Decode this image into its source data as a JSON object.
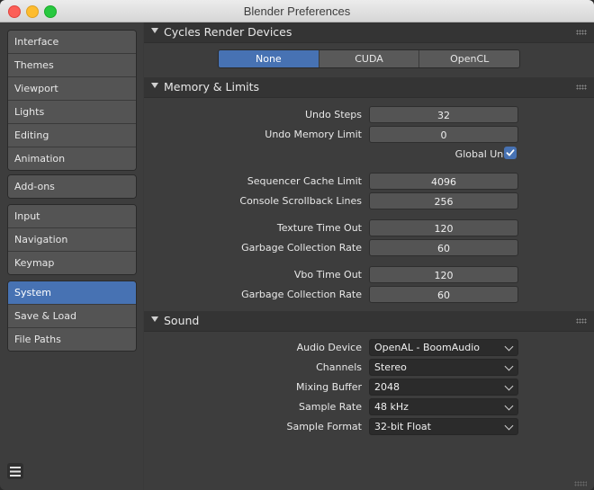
{
  "window": {
    "title": "Blender Preferences"
  },
  "sidebar": {
    "groups": [
      [
        "Interface",
        "Themes",
        "Viewport",
        "Lights",
        "Editing",
        "Animation"
      ],
      [
        "Add-ons"
      ],
      [
        "Input",
        "Navigation",
        "Keymap"
      ],
      [
        "System",
        "Save & Load",
        "File Paths"
      ]
    ],
    "active_item": "System"
  },
  "panels": {
    "cycles": {
      "title": "Cycles Render Devices",
      "options": [
        "None",
        "CUDA",
        "OpenCL"
      ],
      "selected": "None"
    },
    "memory": {
      "title": "Memory & Limits",
      "undo_steps": {
        "label": "Undo Steps",
        "value": "32"
      },
      "undo_memory_limit": {
        "label": "Undo Memory Limit",
        "value": "0"
      },
      "global_undo": {
        "label": "Global Undo",
        "checked": true
      },
      "sequencer_cache_limit": {
        "label": "Sequencer Cache Limit",
        "value": "4096"
      },
      "console_scrollback": {
        "label": "Console Scrollback Lines",
        "value": "256"
      },
      "texture_time_out": {
        "label": "Texture Time Out",
        "value": "120"
      },
      "texture_gc_rate": {
        "label": "Garbage Collection Rate",
        "value": "60"
      },
      "vbo_time_out": {
        "label": "Vbo Time Out",
        "value": "120"
      },
      "vbo_gc_rate": {
        "label": "Garbage Collection Rate",
        "value": "60"
      }
    },
    "sound": {
      "title": "Sound",
      "audio_device": {
        "label": "Audio Device",
        "value": "OpenAL - BoomAudio"
      },
      "channels": {
        "label": "Channels",
        "value": "Stereo"
      },
      "mixing_buffer": {
        "label": "Mixing Buffer",
        "value": "2048"
      },
      "sample_rate": {
        "label": "Sample Rate",
        "value": "48 kHz"
      },
      "sample_format": {
        "label": "Sample Format",
        "value": "32-bit Float"
      }
    }
  },
  "colors": {
    "accent": "#4772b3",
    "background": "#3d3d3d",
    "field": "#545454"
  },
  "icons": [
    "close-button",
    "minimize-button",
    "maximize-button",
    "hamburger-menu-icon",
    "checkmark-icon",
    "chevron-down-icon",
    "panel-grip-icon"
  ]
}
